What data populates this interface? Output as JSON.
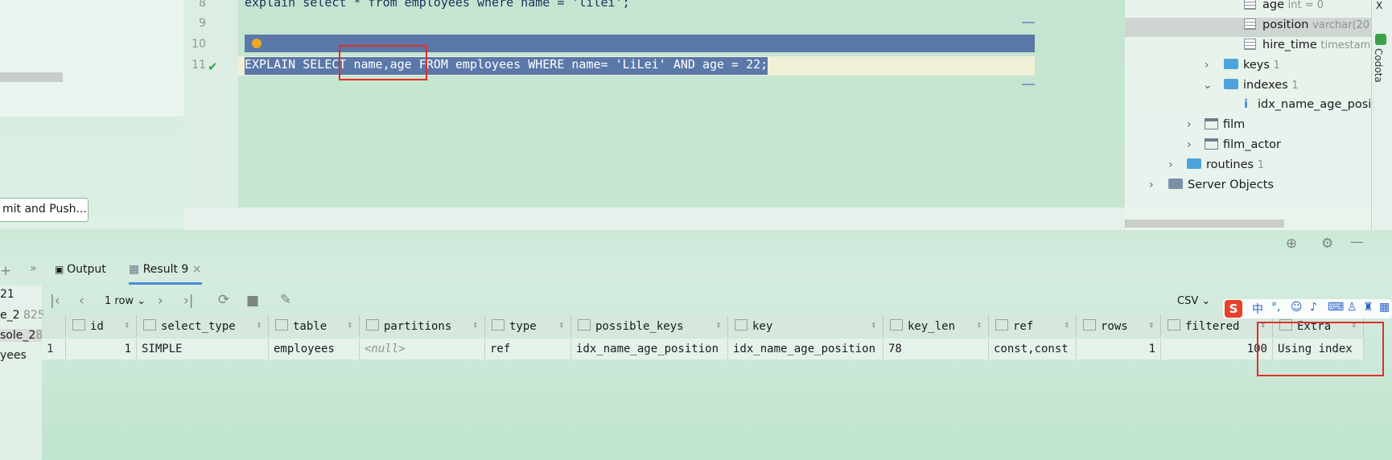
{
  "editor": {
    "lines": [
      {
        "num": "8",
        "code": "explain select * from employees where name = 'lilei';"
      },
      {
        "num": "9",
        "code": ""
      },
      {
        "num": "10",
        "code": ""
      },
      {
        "num": "11",
        "code": "EXPLAIN SELECT name,age FROM employees WHERE name= 'LiLei' AND age = 22;"
      }
    ]
  },
  "left_panel": {
    "commit_button": "mit and Push...",
    "items": [
      "21",
      "e_2",
      "sole_2",
      "yees"
    ],
    "item_counts": [
      "",
      "825",
      "8",
      ""
    ]
  },
  "tree": {
    "rows": [
      {
        "label": "age",
        "hint": "int = 0"
      },
      {
        "label": "position",
        "hint": "varchar(20"
      },
      {
        "label": "hire_time",
        "hint": "timestamp"
      },
      {
        "label": "keys",
        "hint": "1"
      },
      {
        "label": "indexes",
        "hint": "1"
      },
      {
        "label": "idx_name_age_posit",
        "hint": ""
      },
      {
        "label": "film",
        "hint": ""
      },
      {
        "label": "film_actor",
        "hint": ""
      },
      {
        "label": "routines",
        "hint": "1"
      },
      {
        "label": "Server Objects",
        "hint": ""
      }
    ],
    "side_label": "Codota",
    "top_glyph": "X"
  },
  "services": {
    "tabs": [
      {
        "label": "Output"
      },
      {
        "label": "Result 9"
      }
    ],
    "pager": "1 row",
    "export_format": "CSV"
  },
  "grid": {
    "columns": [
      "id",
      "select_type",
      "table",
      "partitions",
      "type",
      "possible_keys",
      "key",
      "key_len",
      "ref",
      "rows",
      "filtered",
      "Extra"
    ],
    "rows": [
      {
        "rownum": "1",
        "cells": [
          "1",
          "SIMPLE",
          "employees",
          "<null>",
          "ref",
          "idx_name_age_position",
          "idx_name_age_position",
          "78",
          "const,const",
          "1",
          "100",
          "Using index"
        ]
      }
    ]
  },
  "ime": {
    "logo": "S",
    "mode": "中"
  },
  "colors": {
    "selection": "#5a78a8",
    "highlight_box": "#e0302a",
    "accent_tab": "#4f8bd6"
  }
}
